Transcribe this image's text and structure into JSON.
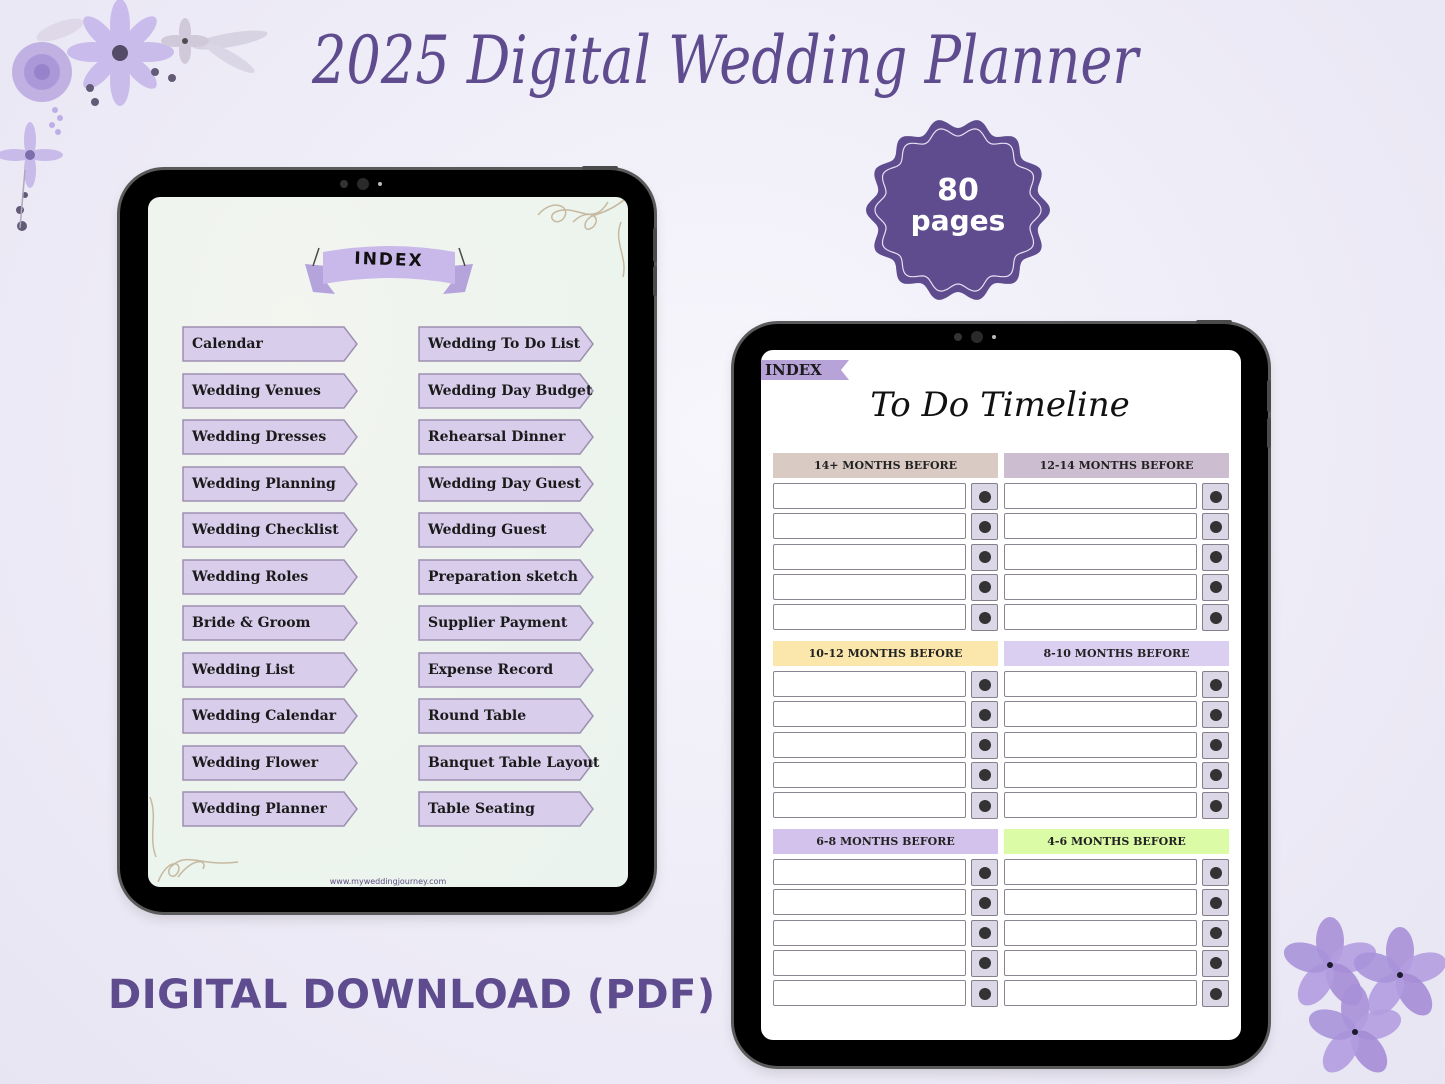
{
  "header": {
    "title": "2025 Digital Wedding Planner"
  },
  "badge": {
    "number": "80",
    "word": "pages",
    "color": "#5e4c8f"
  },
  "footer": {
    "download_label": "DIGITAL DOWNLOAD (PDF)"
  },
  "decorations": {
    "top_left": "lavender-floral-corner",
    "bottom_right": "purple-five-petal-flowers"
  },
  "index_page": {
    "banner_label": "INDEX",
    "left_column": [
      "Calendar",
      "Wedding Venues",
      "Wedding Dresses",
      "Wedding Planning",
      "Wedding Checklist",
      "Wedding Roles",
      "Bride & Groom",
      "Wedding List",
      "Wedding Calendar",
      "Wedding Flower",
      "Wedding Planner"
    ],
    "right_column": [
      "Wedding To Do List",
      "Wedding Day Budget",
      "Rehearsal Dinner",
      "Wedding Day Guest",
      "Wedding Guest",
      "Preparation sketch",
      "Supplier Payment",
      "Expense Record",
      "Round Table",
      "Banquet Table Layout",
      "Table Seating"
    ],
    "website": "www.myweddingjourney.com",
    "tag_color": "#d8cdeb"
  },
  "timeline_page": {
    "index_tab_label": "INDEX",
    "title": "To Do Timeline",
    "sections": [
      {
        "label": "14+ MONTHS BEFORE",
        "color": "#d9cbc3",
        "rows": 5
      },
      {
        "label": "12-14 MONTHS BEFORE",
        "color": "#cdbdd0",
        "rows": 5
      },
      {
        "label": "10-12 MONTHS BEFORE",
        "color": "#fbe6ac",
        "rows": 5
      },
      {
        "label": "8-10 MONTHS BEFORE",
        "color": "#dacff0",
        "rows": 5
      },
      {
        "label": "6-8 MONTHS BEFORE",
        "color": "#d3c3ec",
        "rows": 5
      },
      {
        "label": "4-6 MONTHS BEFORE",
        "color": "#dbfba7",
        "rows": 5
      }
    ]
  }
}
